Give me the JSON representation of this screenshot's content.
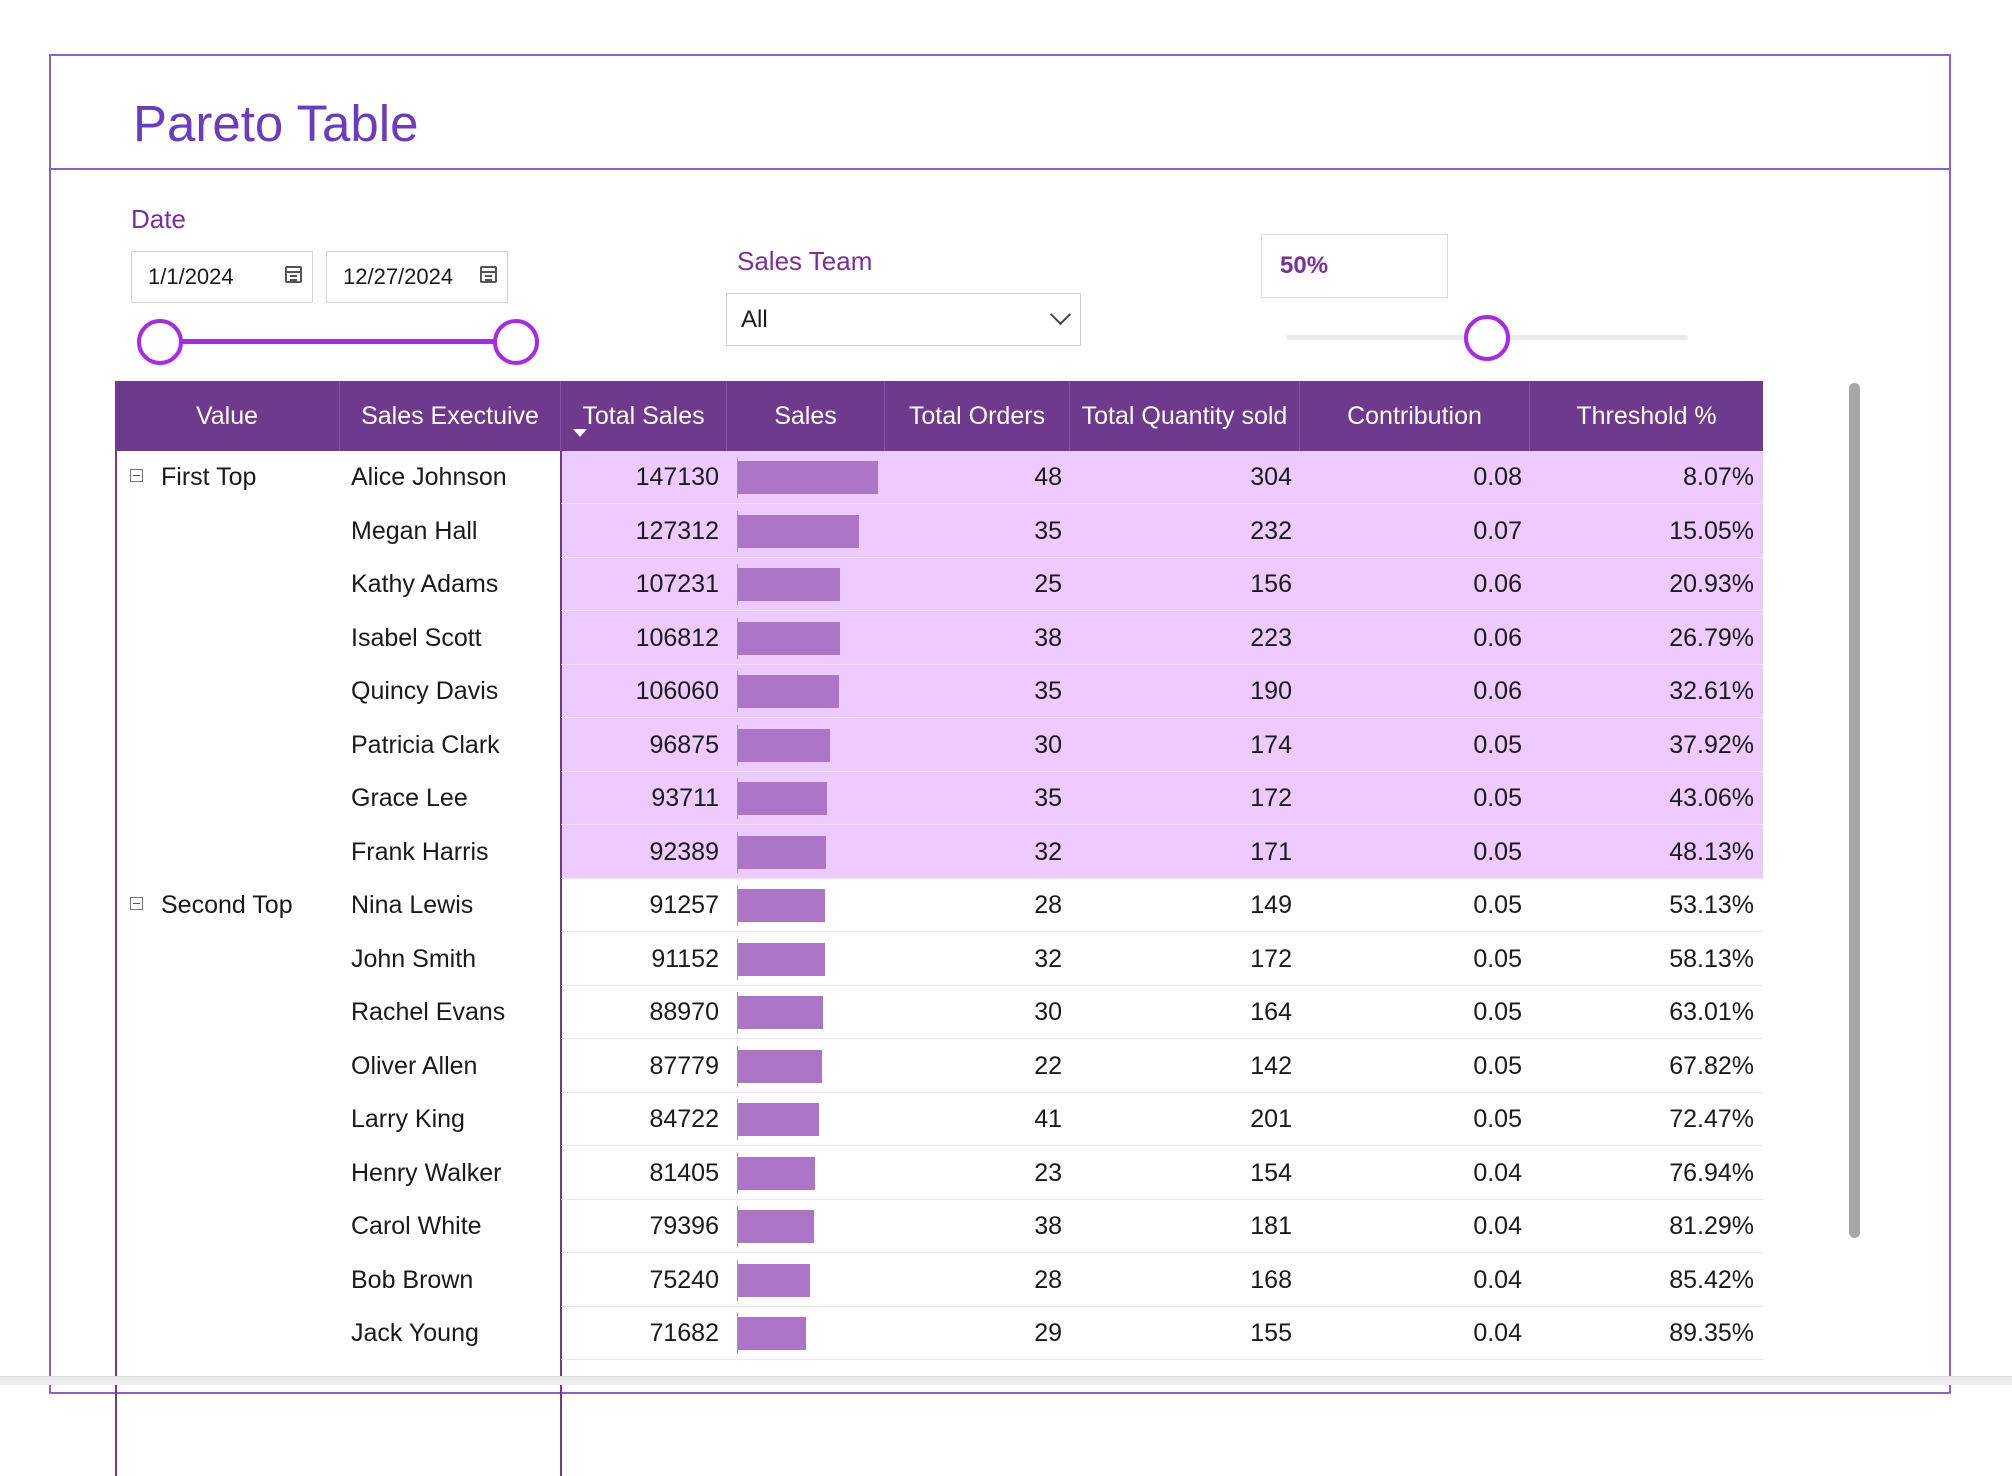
{
  "page": {
    "title": "Pareto Table"
  },
  "filters": {
    "date_label": "Date",
    "start_date": "1/1/2024",
    "end_date": "12/27/2024",
    "sales_team_label": "Sales Team",
    "sales_team_value": "All",
    "threshold_value": "50%",
    "threshold_level": 0.5
  },
  "colors": {
    "accent": "#6e3a8e",
    "highlight": "#edcaff",
    "bar": "#ad75c8",
    "title": "#6a3cc4",
    "slider": "#a82ae8"
  },
  "table": {
    "columns": [
      "Value",
      "Sales Exectuive",
      "Total Sales",
      "Sales",
      "Total Orders",
      "Total Quantity sold",
      "Contribution",
      "Threshold %"
    ],
    "groups": [
      {
        "label": "First Top",
        "highlighted": true
      },
      {
        "label": "Second Top",
        "highlighted": false
      }
    ],
    "rows": [
      {
        "group": 0,
        "exec": "Alice Johnson",
        "total_sales": "147130",
        "sales": 147130,
        "orders": "48",
        "qty": "304",
        "contribution": "0.08",
        "threshold": "8.07%"
      },
      {
        "group": 0,
        "exec": "Megan Hall",
        "total_sales": "127312",
        "sales": 127312,
        "orders": "35",
        "qty": "232",
        "contribution": "0.07",
        "threshold": "15.05%"
      },
      {
        "group": 0,
        "exec": "Kathy Adams",
        "total_sales": "107231",
        "sales": 107231,
        "orders": "25",
        "qty": "156",
        "contribution": "0.06",
        "threshold": "20.93%"
      },
      {
        "group": 0,
        "exec": "Isabel Scott",
        "total_sales": "106812",
        "sales": 106812,
        "orders": "38",
        "qty": "223",
        "contribution": "0.06",
        "threshold": "26.79%"
      },
      {
        "group": 0,
        "exec": "Quincy Davis",
        "total_sales": "106060",
        "sales": 106060,
        "orders": "35",
        "qty": "190",
        "contribution": "0.06",
        "threshold": "32.61%"
      },
      {
        "group": 0,
        "exec": "Patricia Clark",
        "total_sales": "96875",
        "sales": 96875,
        "orders": "30",
        "qty": "174",
        "contribution": "0.05",
        "threshold": "37.92%"
      },
      {
        "group": 0,
        "exec": "Grace Lee",
        "total_sales": "93711",
        "sales": 93711,
        "orders": "35",
        "qty": "172",
        "contribution": "0.05",
        "threshold": "43.06%"
      },
      {
        "group": 0,
        "exec": "Frank Harris",
        "total_sales": "92389",
        "sales": 92389,
        "orders": "32",
        "qty": "171",
        "contribution": "0.05",
        "threshold": "48.13%"
      },
      {
        "group": 1,
        "exec": "Nina Lewis",
        "total_sales": "91257",
        "sales": 91257,
        "orders": "28",
        "qty": "149",
        "contribution": "0.05",
        "threshold": "53.13%"
      },
      {
        "group": 1,
        "exec": "John Smith",
        "total_sales": "91152",
        "sales": 91152,
        "orders": "32",
        "qty": "172",
        "contribution": "0.05",
        "threshold": "58.13%"
      },
      {
        "group": 1,
        "exec": "Rachel Evans",
        "total_sales": "88970",
        "sales": 88970,
        "orders": "30",
        "qty": "164",
        "contribution": "0.05",
        "threshold": "63.01%"
      },
      {
        "group": 1,
        "exec": "Oliver Allen",
        "total_sales": "87779",
        "sales": 87779,
        "orders": "22",
        "qty": "142",
        "contribution": "0.05",
        "threshold": "67.82%"
      },
      {
        "group": 1,
        "exec": "Larry King",
        "total_sales": "84722",
        "sales": 84722,
        "orders": "41",
        "qty": "201",
        "contribution": "0.05",
        "threshold": "72.47%"
      },
      {
        "group": 1,
        "exec": "Henry Walker",
        "total_sales": "81405",
        "sales": 81405,
        "orders": "23",
        "qty": "154",
        "contribution": "0.04",
        "threshold": "76.94%"
      },
      {
        "group": 1,
        "exec": "Carol White",
        "total_sales": "79396",
        "sales": 79396,
        "orders": "38",
        "qty": "181",
        "contribution": "0.04",
        "threshold": "81.29%"
      },
      {
        "group": 1,
        "exec": "Bob Brown",
        "total_sales": "75240",
        "sales": 75240,
        "orders": "28",
        "qty": "168",
        "contribution": "0.04",
        "threshold": "85.42%"
      },
      {
        "group": 1,
        "exec": "Jack Young",
        "total_sales": "71682",
        "sales": 71682,
        "orders": "29",
        "qty": "155",
        "contribution": "0.04",
        "threshold": "89.35%"
      }
    ]
  }
}
